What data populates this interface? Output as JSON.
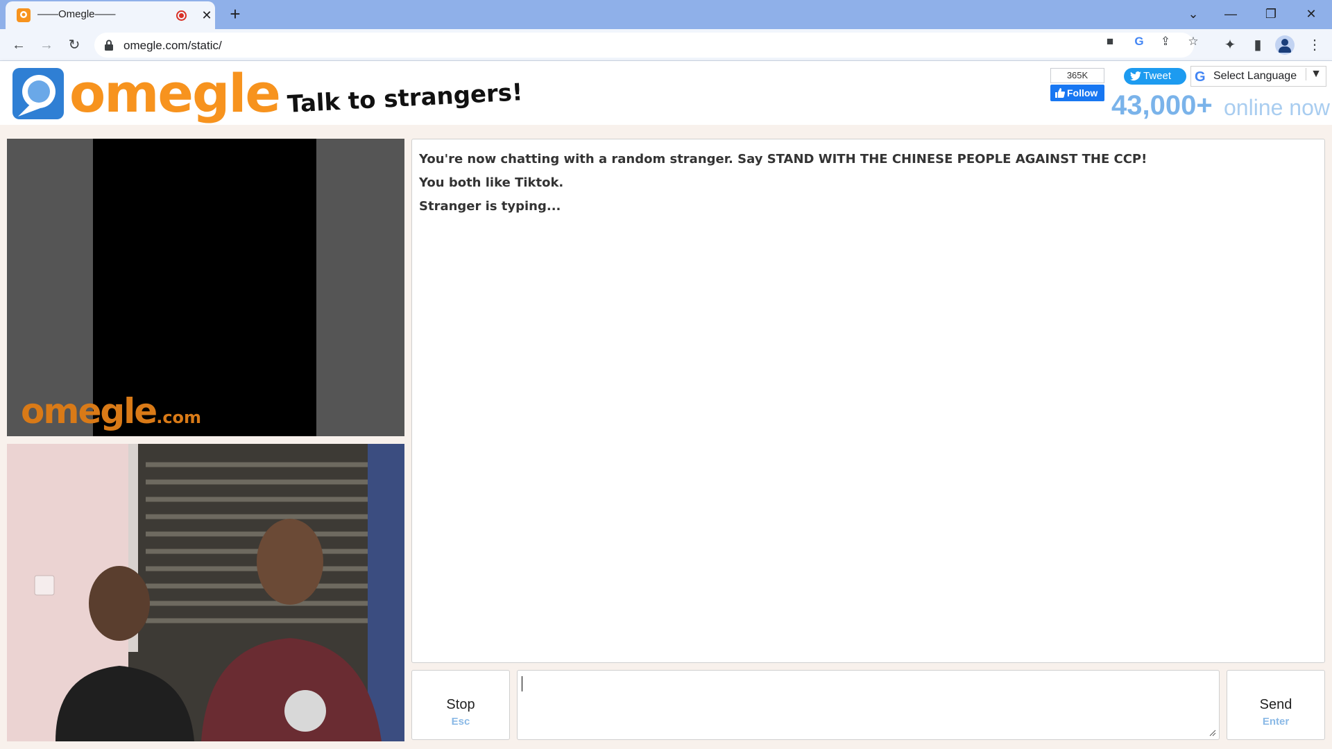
{
  "browser": {
    "tab_title": "——Omegle——",
    "url": "omegle.com/static/",
    "window_controls": [
      "chevron-down-icon",
      "minimize-icon",
      "restore-icon",
      "close-icon"
    ]
  },
  "header": {
    "logo_text": "omegle",
    "tagline": "Talk to strangers!",
    "facebook": {
      "count": "365K",
      "follow_label": "Follow"
    },
    "tweet_label": "Tweet",
    "language_label": "Select Language",
    "online_count": "43,000+",
    "online_label": "online now"
  },
  "video": {
    "watermark": "omegle",
    "watermark_suffix": ".com"
  },
  "chat": {
    "lines": [
      "You're now chatting with a random stranger. Say STAND WITH THE CHINESE PEOPLE AGAINST THE CCP!",
      "You both like Tiktok.",
      "Stranger is typing..."
    ],
    "input_value": ""
  },
  "controls": {
    "stop_label": "Stop",
    "stop_hint": "Esc",
    "send_label": "Send",
    "send_hint": "Enter"
  },
  "colors": {
    "brand_orange": "#f7931e",
    "online_blue": "#7ab3ea",
    "page_bg": "#f8f1ec"
  }
}
